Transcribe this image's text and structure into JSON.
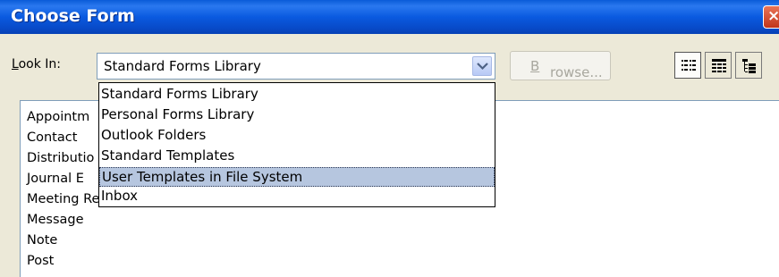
{
  "window": {
    "title": "Choose Form",
    "close_label": "×"
  },
  "lookin": {
    "label_underlined": "L",
    "label_rest": "ook In:",
    "value": "Standard Forms Library"
  },
  "browse": {
    "label_underlined": "B",
    "label_rest": "rowse..."
  },
  "view_buttons": [
    "list-view-icon",
    "details-view-icon",
    "tree-view-icon"
  ],
  "list_items": [
    "Appointm",
    "Contact",
    "Distributio",
    "Journal E",
    "Meeting Request",
    "Message",
    "Note",
    "Post"
  ],
  "dropdown": {
    "options": [
      "Standard Forms Library",
      "Personal Forms Library",
      "Outlook Folders",
      "Standard Templates",
      "User Templates in File System",
      "Inbox"
    ],
    "selected_index": 4
  },
  "colors": {
    "titlebar": "#0a5ae0",
    "selection": "#b6c6df",
    "dialog_bg": "#ece9d8"
  }
}
